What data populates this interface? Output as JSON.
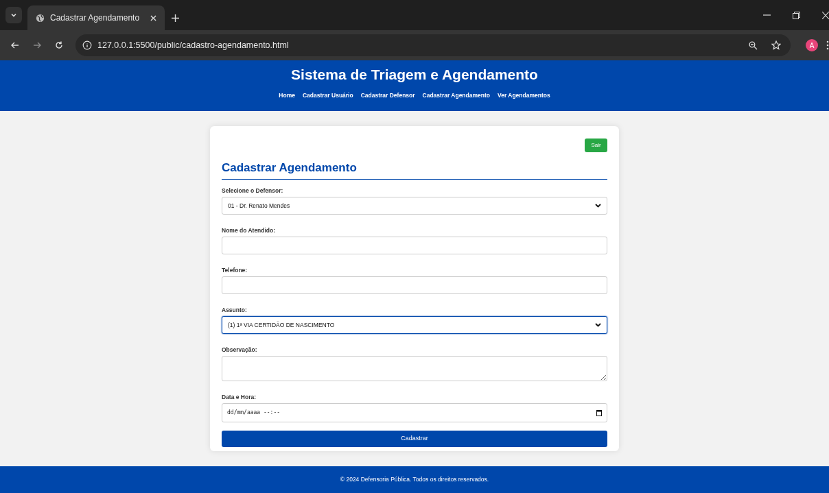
{
  "browser": {
    "tab_title": "Cadastrar Agendamento",
    "url": "127.0.0.1:5500/public/cadastro-agendamento.html",
    "profile_initial": "A"
  },
  "header": {
    "title": "Sistema de Triagem e Agendamento",
    "nav": [
      {
        "label": "Home"
      },
      {
        "label": "Cadastrar Usuário"
      },
      {
        "label": "Cadastrar Defensor"
      },
      {
        "label": "Cadastrar Agendamento"
      },
      {
        "label": "Ver Agendamentos"
      }
    ]
  },
  "form": {
    "logout_button": "Sair",
    "title": "Cadastrar Agendamento",
    "fields": [
      {
        "kind": "select",
        "label": "Selecione o Defensor:",
        "value": "01 - Dr. Renato Mendes",
        "focused": false
      },
      {
        "kind": "text",
        "label": "Nome do Atendido:",
        "focused": false
      },
      {
        "kind": "text",
        "label": "Telefone:",
        "focused": false
      },
      {
        "kind": "select",
        "label": "Assunto:",
        "value": "(1) 1ª VIA CERTIDÃO DE NASCIMENTO",
        "focused": true
      },
      {
        "kind": "textarea",
        "label": "Observação:",
        "focused": false
      },
      {
        "kind": "datetime",
        "label": "Data e Hora:",
        "placeholder": "dd/mm/aaaa --:--",
        "focused": false
      }
    ],
    "submit_button": "Cadastrar"
  },
  "footer": {
    "text": "© 2024 Defensoria Pública. Todos os direitos reservados."
  }
}
